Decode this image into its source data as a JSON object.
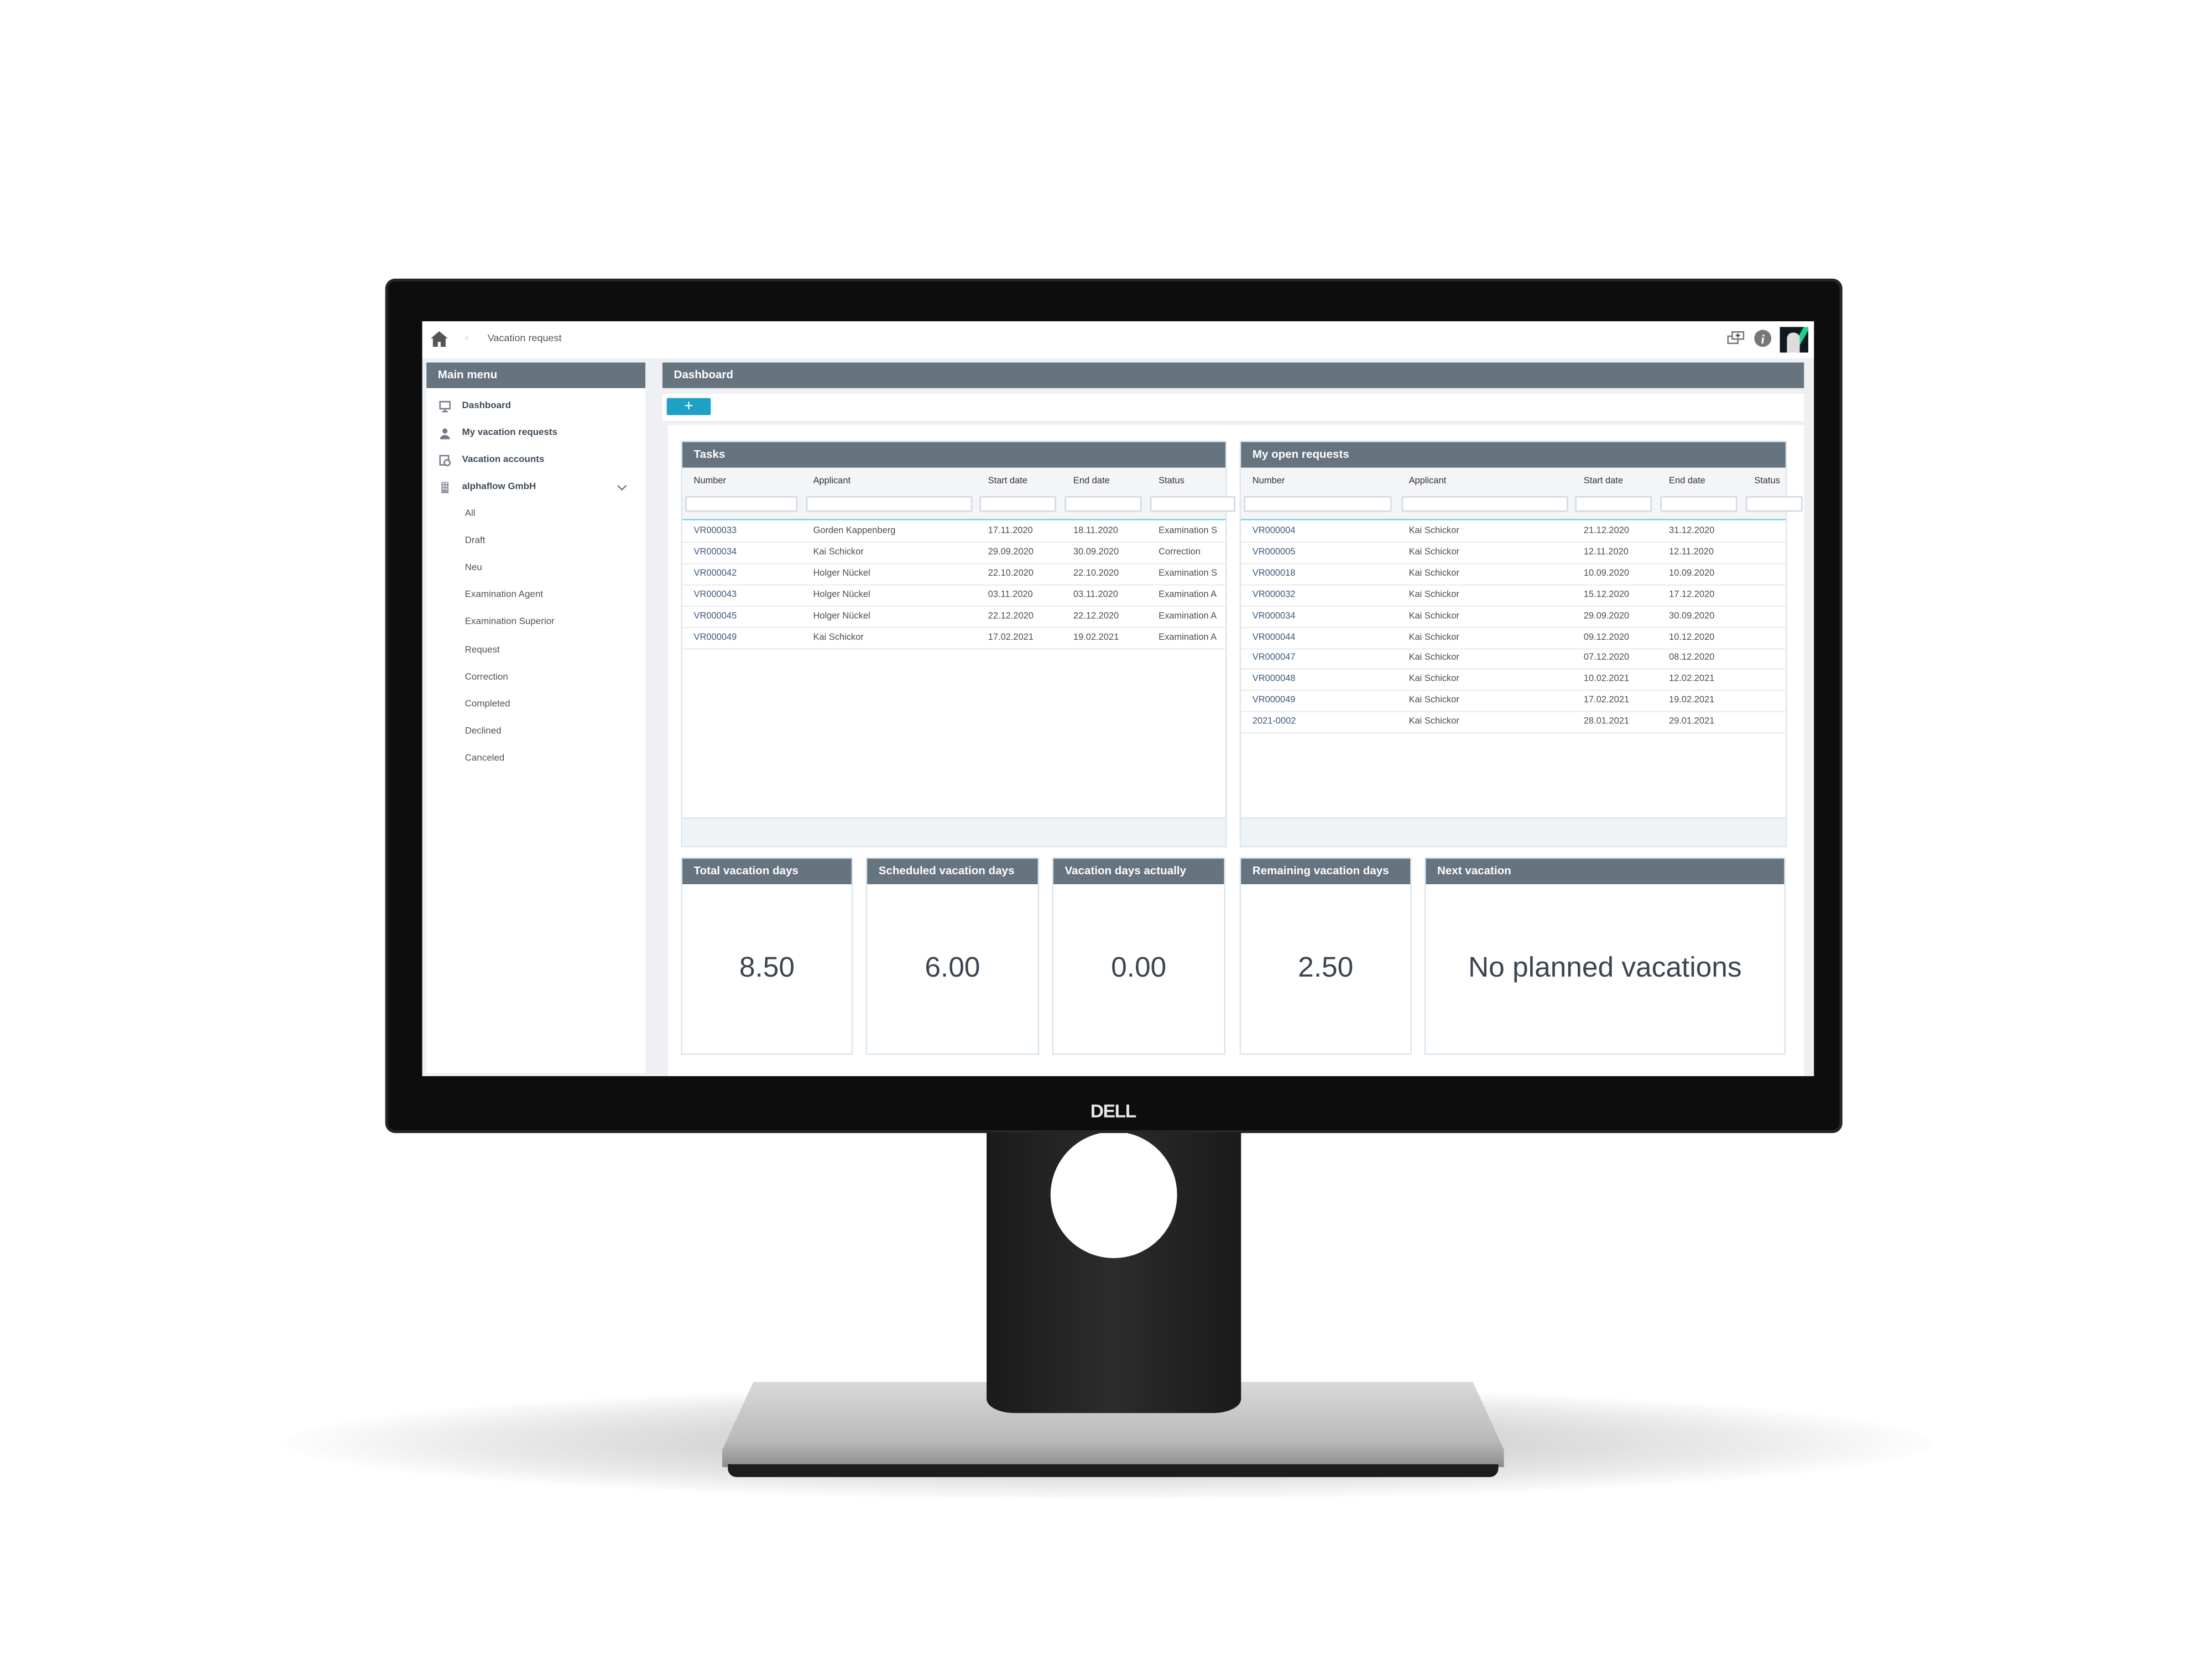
{
  "device": {
    "brand_logo": "DELL"
  },
  "topbar": {
    "home_icon": "home-icon",
    "back_icon": "chevron-left-icon",
    "breadcrumb": "Vacation request",
    "icons": [
      "new-window-icon",
      "info-icon",
      "user-avatar"
    ]
  },
  "sidebar": {
    "title": "Main menu",
    "items": [
      {
        "label": "Dashboard",
        "icon": "monitor-icon"
      },
      {
        "label": "My vacation requests",
        "icon": "user-icon"
      },
      {
        "label": "Vacation accounts",
        "icon": "calendar-clock-icon"
      },
      {
        "label": "alphaflow GmbH",
        "icon": "building-icon",
        "expanded": true
      }
    ],
    "subitems": [
      "All",
      "Draft",
      "Neu",
      "Examination Agent",
      "Examination Superior",
      "Request",
      "Correction",
      "Completed",
      "Declined",
      "Canceled"
    ]
  },
  "main": {
    "title": "Dashboard",
    "add_label": "+",
    "accent": "#1ea1c4",
    "header_color": "#66747f"
  },
  "tasks": {
    "title": "Tasks",
    "columns": [
      "Number",
      "Applicant",
      "Start date",
      "End date",
      "Status"
    ],
    "rows": [
      [
        "VR000033",
        "Gorden Kappenberg",
        "17.11.2020",
        "18.11.2020",
        "Examination S"
      ],
      [
        "VR000034",
        "Kai Schickor",
        "29.09.2020",
        "30.09.2020",
        "Correction"
      ],
      [
        "VR000042",
        "Holger Nückel",
        "22.10.2020",
        "22.10.2020",
        "Examination S"
      ],
      [
        "VR000043",
        "Holger Nückel",
        "03.11.2020",
        "03.11.2020",
        "Examination A"
      ],
      [
        "VR000045",
        "Holger Nückel",
        "22.12.2020",
        "22.12.2020",
        "Examination A"
      ],
      [
        "VR000049",
        "Kai Schickor",
        "17.02.2021",
        "19.02.2021",
        "Examination A"
      ]
    ]
  },
  "open_requests": {
    "title": "My open requests",
    "columns": [
      "Number",
      "Applicant",
      "Start date",
      "End date",
      "Status"
    ],
    "rows": [
      [
        "VR000004",
        "Kai Schickor",
        "21.12.2020",
        "31.12.2020",
        ""
      ],
      [
        "VR000005",
        "Kai Schickor",
        "12.11.2020",
        "12.11.2020",
        ""
      ],
      [
        "VR000018",
        "Kai Schickor",
        "10.09.2020",
        "10.09.2020",
        ""
      ],
      [
        "VR000032",
        "Kai Schickor",
        "15.12.2020",
        "17.12.2020",
        ""
      ],
      [
        "VR000034",
        "Kai Schickor",
        "29.09.2020",
        "30.09.2020",
        ""
      ],
      [
        "VR000044",
        "Kai Schickor",
        "09.12.2020",
        "10.12.2020",
        ""
      ],
      [
        "VR000047",
        "Kai Schickor",
        "07.12.2020",
        "08.12.2020",
        ""
      ],
      [
        "VR000048",
        "Kai Schickor",
        "10.02.2021",
        "12.02.2021",
        ""
      ],
      [
        "VR000049",
        "Kai Schickor",
        "17.02.2021",
        "19.02.2021",
        ""
      ],
      [
        "2021-0002",
        "Kai Schickor",
        "28.01.2021",
        "29.01.2021",
        ""
      ]
    ]
  },
  "kpis": [
    {
      "title": "Total vacation days",
      "value": "8.50"
    },
    {
      "title": "Scheduled vacation days",
      "value": "6.00"
    },
    {
      "title": "Vacation days actually",
      "value": "0.00"
    },
    {
      "title": "Remaining vacation days",
      "value": "2.50"
    },
    {
      "title": "Next vacation",
      "value": "No planned vacations"
    }
  ]
}
